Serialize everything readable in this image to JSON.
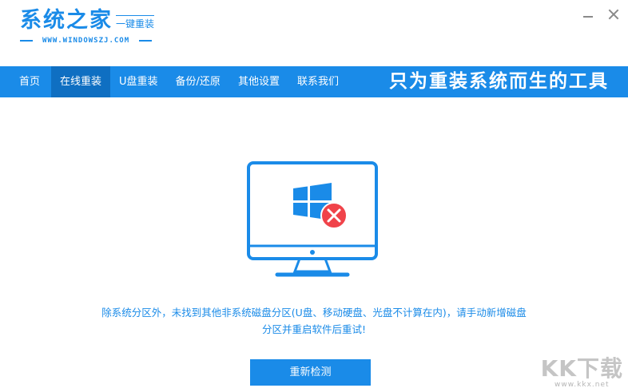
{
  "header": {
    "logo_title": "系统之家",
    "logo_subtitle": "一键重装",
    "logo_url": "WWW.WINDOWSZJ.COM"
  },
  "nav": {
    "items": [
      {
        "label": "首页"
      },
      {
        "label": "在线重装"
      },
      {
        "label": "U盘重装"
      },
      {
        "label": "备份/还原"
      },
      {
        "label": "其他设置"
      },
      {
        "label": "联系我们"
      }
    ],
    "active_index": 1,
    "slogan": "只为重装系统而生的工具"
  },
  "main": {
    "error_line1": "除系统分区外，未找到其他非系统磁盘分区(U盘、移动硬盘、光盘不计算在内)，请手动新增磁盘",
    "error_line2": "分区并重启软件后重试!",
    "recheck_label": "重新检测"
  },
  "watermark": {
    "logo": "KK下载",
    "url": "www.kkx.net"
  },
  "colors": {
    "accent": "#1a8be8",
    "nav_active": "#0f6fc2",
    "error_red": "#f0434a"
  },
  "icons": {
    "monitor": "monitor-icon",
    "windows": "windows-logo-icon",
    "error": "error-x-icon"
  }
}
